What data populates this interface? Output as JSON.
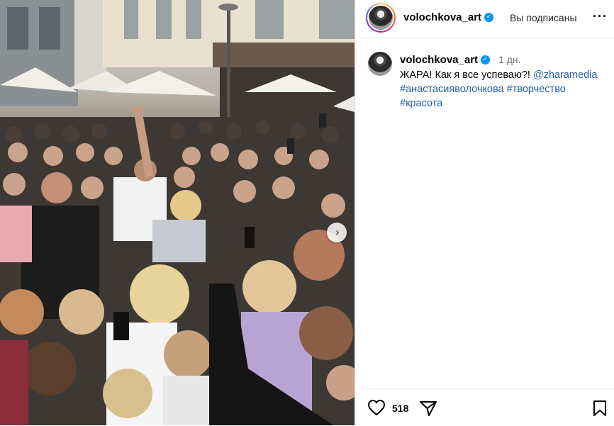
{
  "post": {
    "username": "volochkova_art",
    "follow_status": "Вы подписаны",
    "more_label": "···"
  },
  "caption": {
    "username": "volochkova_art",
    "time": "1 дн.",
    "text": "ЖАРА! Как я все успеваю?! ",
    "mention": "@zharamedia",
    "hashtags": [
      "#анастасияволочкова",
      "#творчество",
      "#красота"
    ]
  },
  "actions": {
    "likes": "518",
    "icons": [
      "heart-icon",
      "share-icon",
      "bookmark-icon"
    ]
  },
  "media": {
    "description_icons": [
      "chevron-right-icon"
    ]
  },
  "colors": {
    "link": "#1f5fa8",
    "verified": "#0095f6",
    "muted": "#737373"
  }
}
